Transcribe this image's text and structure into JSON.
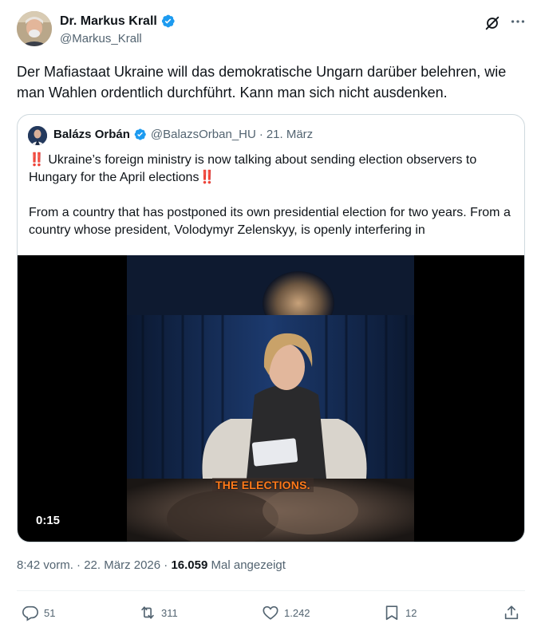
{
  "author": {
    "name": "Dr. Markus Krall",
    "handle": "@Markus_Krall",
    "verified_color": "#1d9bf0"
  },
  "tweet_text": "Der Mafiastaat Ukraine will das demokratische Ungarn darüber belehren, wie man Wahlen ordentlich durchführt. Kann man sich nicht ausdenken.",
  "quoted": {
    "name": "Balázs Orbán",
    "handle": "@BalazsOrban_HU",
    "separator": "·",
    "date": "21. März",
    "paragraph1": "‼️ Ukraine’s foreign ministry is now talking about sending election observers to Hungary for the April elections‼️",
    "paragraph2": "From a country that has postponed its own presidential election for two years. From a country whose president, Volodymyr Zelenskyy, is openly interfering in",
    "video": {
      "duration": "0:15",
      "caption": "THE ELECTIONS."
    }
  },
  "meta": {
    "time": "8:42 vorm.",
    "separator": "·",
    "date": "22. März 2026",
    "separator2": "·",
    "views_count": "16.059",
    "views_label": "Mal angezeigt"
  },
  "actions": {
    "replies": "51",
    "reposts": "311",
    "likes": "1.242",
    "bookmarks": "12"
  },
  "icons": [
    "verified-badge-icon",
    "grok-icon",
    "more-icon",
    "reply-icon",
    "repost-icon",
    "like-icon",
    "bookmark-icon",
    "share-icon"
  ]
}
